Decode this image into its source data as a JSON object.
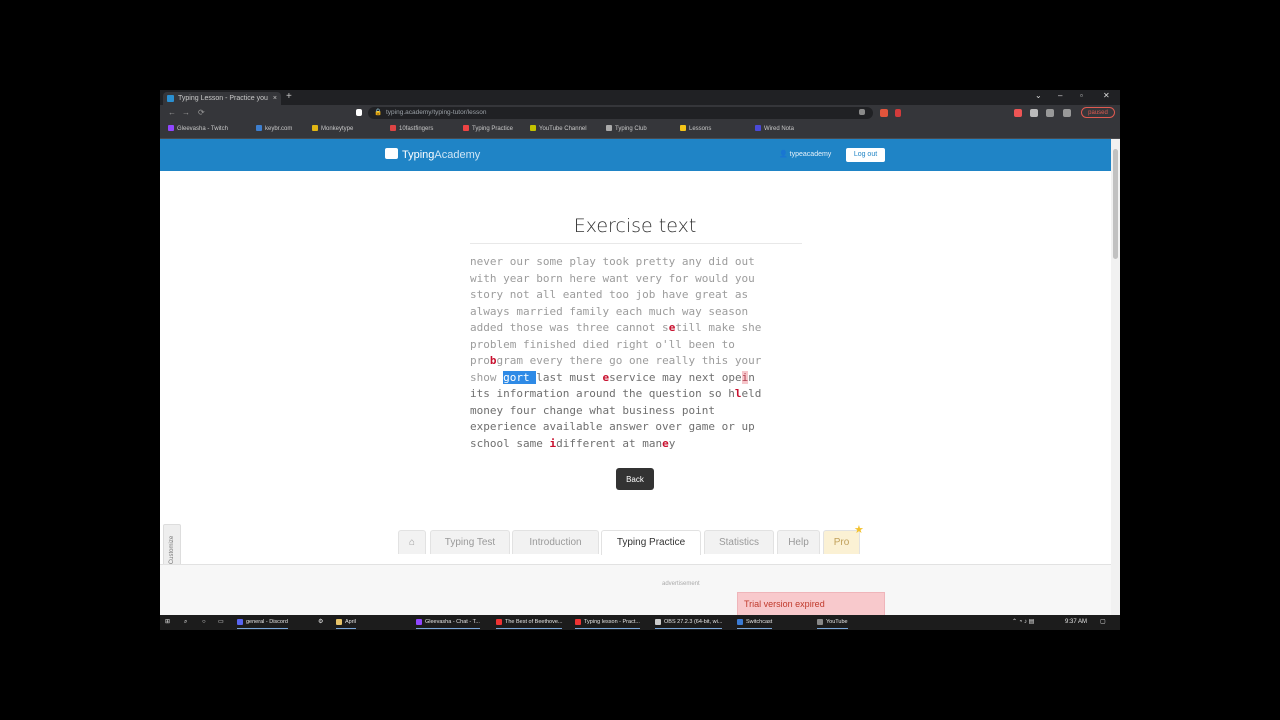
{
  "browser": {
    "tab_title": "Typing Lesson - Practice your ty...",
    "tab_close": "×",
    "new_tab": "+",
    "url": "typing.academy/typing-tutor/lesson",
    "lock": "🔒",
    "pause_label": "paused",
    "win_controls": [
      "⌄",
      "–",
      "▫",
      "✕"
    ],
    "nav": [
      "←",
      "→",
      "⟳"
    ],
    "bookmarks": [
      {
        "label": "Gleevasha - Twitch",
        "color": "#9146ff"
      },
      {
        "label": "keybr.com",
        "color": "#3d7fcf"
      },
      {
        "label": "Monkeytype",
        "color": "#e2b714"
      },
      {
        "label": "10fastfingers",
        "color": "#d44"
      },
      {
        "label": "Typing Practice",
        "color": "#e44"
      },
      {
        "label": "YouTube Channel",
        "color": "#c3c300"
      },
      {
        "label": "Typing Club",
        "color": "#aaa"
      },
      {
        "label": "Lessons",
        "color": "#f5c518"
      },
      {
        "label": "Wired Nota",
        "color": "#4a4ad8"
      }
    ]
  },
  "header": {
    "logo_typing": "Typing",
    "logo_academy": "Academy",
    "user_icon": "👤",
    "username": "typeacademy",
    "logout_label": "Log out"
  },
  "exercise": {
    "title": "Exercise text",
    "back_label": "Back"
  },
  "footer_tabs": {
    "home_icon": "⌂",
    "typing_test": "Typing Test",
    "introduction": "Introduction",
    "typing_practice": "Typing Practice",
    "statistics": "Statistics",
    "help": "Help",
    "pro": "Pro",
    "pro_star": "★"
  },
  "side_tab_label": "Customize",
  "advertisement": "advertisement",
  "trial_notice": "Trial version expired",
  "taskbar": {
    "time": "9:37 AM",
    "apps": [
      {
        "label": "general - Discord",
        "color": "#5865f2"
      },
      {
        "label": "April",
        "color": "#e6c36a"
      },
      {
        "label": "Gleevasha - Chat - T...",
        "color": "#9146ff"
      },
      {
        "label": "The Best of Beethove...",
        "color": "#e33"
      },
      {
        "label": "Typing lesson - Pract...",
        "color": "#e33"
      },
      {
        "label": "OBS 27.2.3 (64-bit, wi...",
        "color": "#ccc"
      },
      {
        "label": "Switchcast",
        "color": "#3a7bd5"
      },
      {
        "label": "YouTube",
        "color": "#888"
      }
    ]
  }
}
